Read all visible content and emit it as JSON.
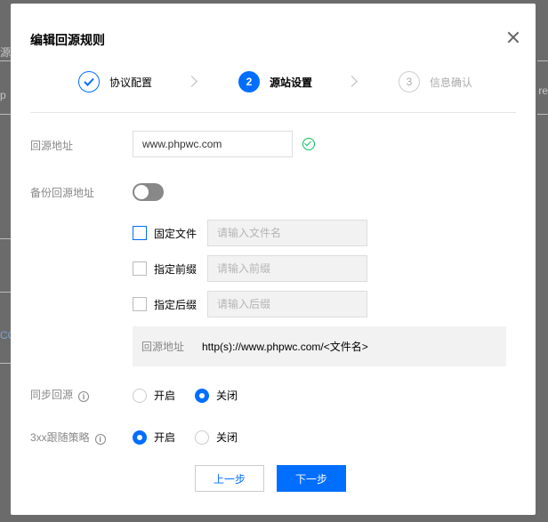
{
  "dialog": {
    "title": "编辑回源规则",
    "steps": [
      {
        "num": "",
        "label": "协议配置",
        "state": "done"
      },
      {
        "num": "2",
        "label": "源站设置",
        "state": "active"
      },
      {
        "num": "3",
        "label": "信息确认",
        "state": "todo"
      }
    ],
    "origin": {
      "label": "回源地址",
      "value": "www.phpwc.com"
    },
    "backup": {
      "label": "备份回源地址"
    },
    "rules": [
      {
        "label": "固定文件",
        "placeholder": "请输入文件名"
      },
      {
        "label": "指定前缀",
        "placeholder": "请输入前缀"
      },
      {
        "label": "指定后缀",
        "placeholder": "请输入后缀"
      }
    ],
    "preview": {
      "label": "回源地址",
      "value": "http(s)://www.phpwc.com/<文件名>"
    },
    "sync": {
      "label": "同步回源",
      "on": "开启",
      "off": "关闭"
    },
    "redirect": {
      "label": "3xx跟随策略",
      "on": "开启",
      "off": "关闭"
    },
    "buttons": {
      "prev": "上一步",
      "next": "下一步"
    }
  },
  "background": {
    "peek_left_1": "源",
    "peek_left_2": "p",
    "peek_left_3": "CO",
    "peek_right_1": "re"
  },
  "colors": {
    "accent": "#006eff",
    "success": "#0abf5b"
  }
}
